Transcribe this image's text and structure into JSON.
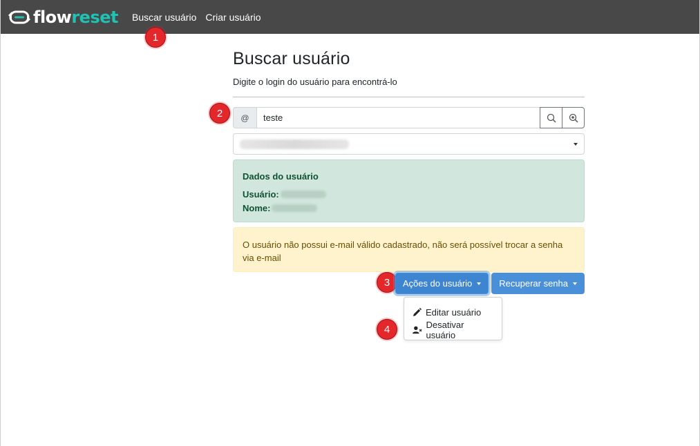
{
  "nav": {
    "logo_flow": "flow",
    "logo_reset": "reset",
    "links": [
      {
        "label": "Buscar usuário"
      },
      {
        "label": "Criar usuário"
      }
    ]
  },
  "markers": [
    "1",
    "2",
    "3",
    "4"
  ],
  "page": {
    "title": "Buscar usuário",
    "subtitle": "Digite o login do usuário para encontrá-lo"
  },
  "search": {
    "prefix": "@",
    "value": "teste"
  },
  "user_card": {
    "title": "Dados do usuário",
    "user_label": "Usuário:",
    "name_label": "Nome:"
  },
  "warning": {
    "text": "O usuário não possui e-mail válido cadastrado, não será possível trocar a senha via e-mail"
  },
  "actions": {
    "user_actions_label": "Ações do usuário",
    "recover_password_label": "Recuperar senha",
    "menu": [
      {
        "label": "Editar usuário",
        "icon": "pencil-icon"
      },
      {
        "label": "Desativar usuário",
        "icon": "user-remove-icon"
      }
    ]
  },
  "colors": {
    "navbar": "#484848",
    "brand_accent": "#1fc2b3",
    "primary": "#4a90d9",
    "marker": "#e3272b"
  }
}
